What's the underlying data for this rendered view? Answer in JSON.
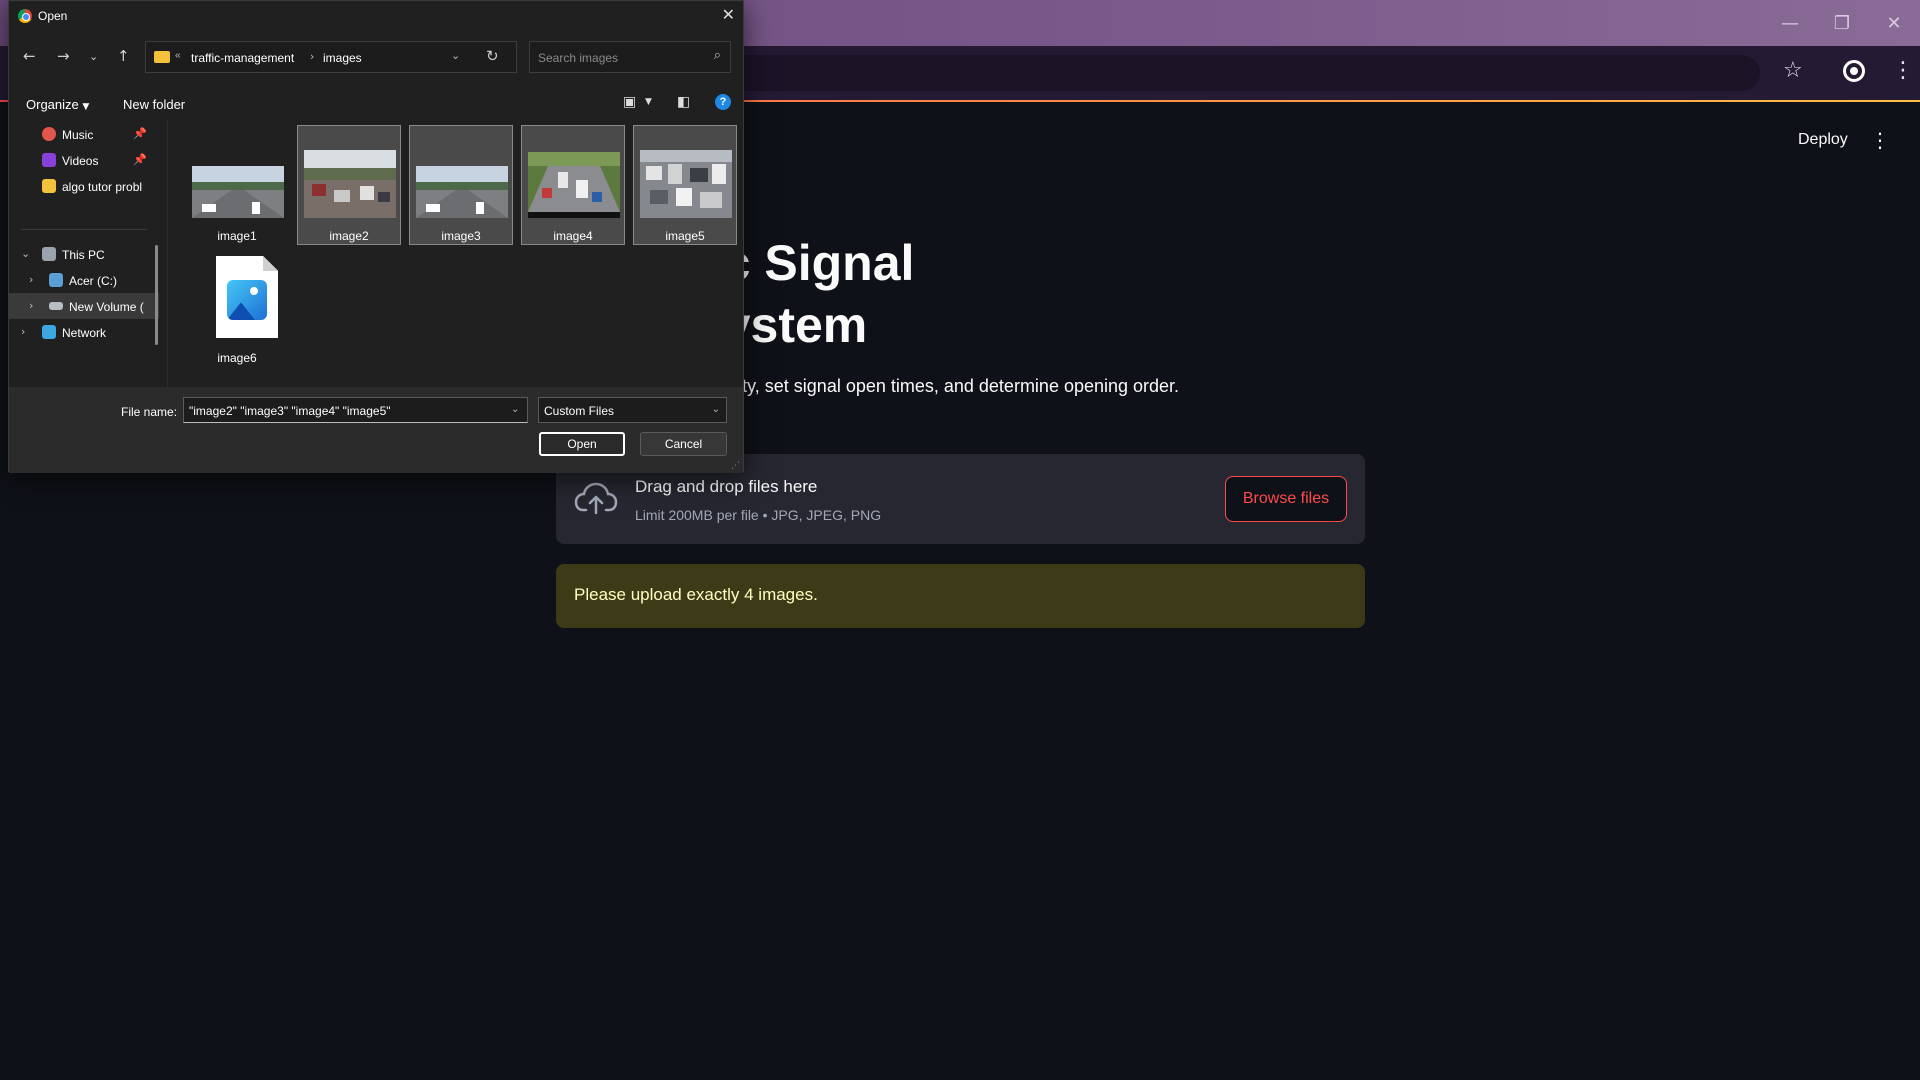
{
  "browser": {
    "window_controls": {
      "minimize": "—",
      "restore": "❐",
      "close": "✕"
    },
    "bookmark_icon": "star-icon",
    "menu_icon": "kebab-menu-icon"
  },
  "app": {
    "deploy_label": "Deploy",
    "title_line1": "d Traffic Signal",
    "title_line2": "ment System",
    "description": "o analyze vehicle density, set signal open times, and determine opening order.",
    "uploader": {
      "drop_text": "Drag and drop files here",
      "limit_text": "Limit 200MB per file • JPG, JPEG, PNG",
      "browse_label": "Browse files"
    },
    "warning_text": "Please upload exactly 4 images.",
    "colors": {
      "accent": "#ff4b4b",
      "warning_bg": "#3d3a17",
      "warning_text": "#ffffc2",
      "background": "#0e1117"
    }
  },
  "dialog": {
    "title": "Open",
    "close_glyph": "✕",
    "path": {
      "crumb1": "traffic-management",
      "crumb2": "images"
    },
    "search_placeholder": "Search images",
    "toolbar": {
      "organize": "Organize",
      "new_folder": "New folder",
      "help": "?"
    },
    "sidebar": {
      "quick": [
        {
          "label": "Music",
          "icon": "music-icon",
          "pinned": true
        },
        {
          "label": "Videos",
          "icon": "videos-icon",
          "pinned": true
        },
        {
          "label": "algo tutor probl",
          "icon": "folder-icon",
          "pinned": false
        }
      ],
      "tree": [
        {
          "label": "This PC",
          "icon": "pc-icon",
          "expanded": true
        },
        {
          "label": "Acer (C:)",
          "icon": "drive-icon"
        },
        {
          "label": "New Volume (",
          "icon": "drive-icon",
          "selected": true
        },
        {
          "label": "Network",
          "icon": "network-icon"
        }
      ]
    },
    "files": [
      {
        "name": "image1",
        "selected": false
      },
      {
        "name": "image2",
        "selected": true
      },
      {
        "name": "image3",
        "selected": true
      },
      {
        "name": "image4",
        "selected": true
      },
      {
        "name": "image5",
        "selected": true
      },
      {
        "name": "image6",
        "selected": false
      }
    ],
    "file_name_label": "File name:",
    "file_name_value": "\"image2\" \"image3\" \"image4\" \"image5\"",
    "file_type": "Custom Files",
    "open_label": "Open",
    "cancel_label": "Cancel"
  }
}
